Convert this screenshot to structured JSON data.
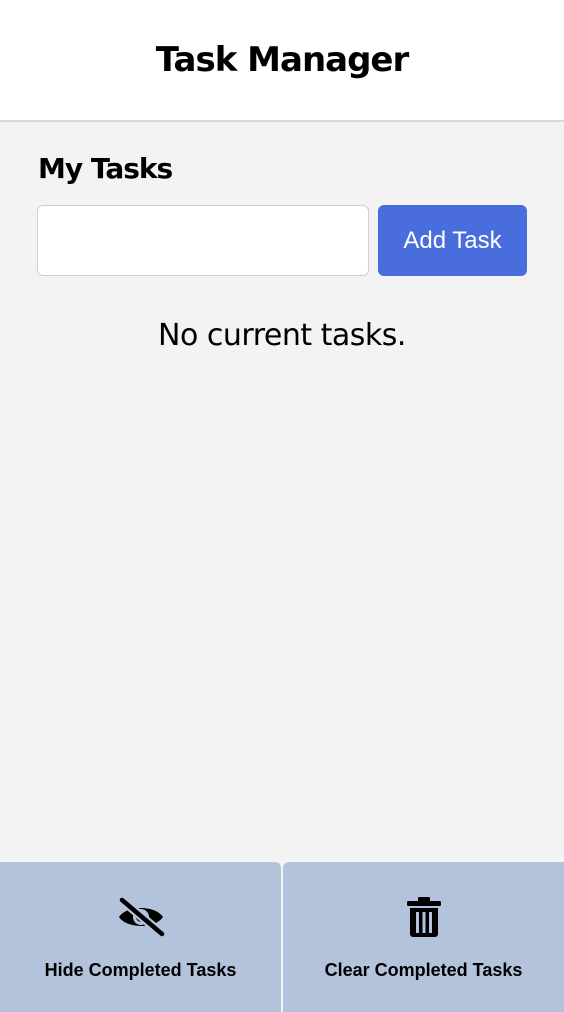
{
  "header": {
    "title": "Task Manager"
  },
  "main": {
    "section_title": "My Tasks",
    "input": {
      "value": "",
      "placeholder": ""
    },
    "add_button_label": "Add Task",
    "empty_message": "No current tasks."
  },
  "footer": {
    "hide_completed": {
      "label": "Hide Completed Tasks",
      "icon": "eye-slash-icon"
    },
    "clear_completed": {
      "label": "Clear Completed Tasks",
      "icon": "trash-icon"
    }
  },
  "colors": {
    "accent": "#4a6ddd",
    "footer_bg": "#b3c3dc",
    "page_bg": "#f3f3f4"
  }
}
